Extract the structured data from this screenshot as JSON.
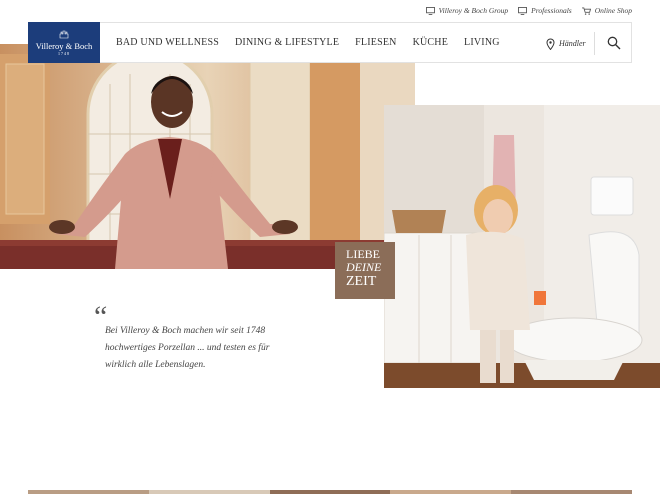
{
  "utility_nav": {
    "group": "Villeroy & Boch Group",
    "professionals": "Professionals",
    "shop": "Online Shop"
  },
  "logo": {
    "brand": "Villeroy & Boch",
    "year": "1748"
  },
  "menu": {
    "items": [
      "BAD UND WELLNESS",
      "DINING & LIFESTYLE",
      "FLIESEN",
      "KÜCHE",
      "LIVING"
    ]
  },
  "header": {
    "dealer_label": "Händler"
  },
  "badge": {
    "line1": "LIEBE",
    "line2": "DEINE",
    "line3": "ZEIT"
  },
  "quote": {
    "mark": "“",
    "text": "Bei Villeroy & Boch machen wir seit 1748 hochwertiges Porzellan ... und testen es für wirklich alle Lebenslagen."
  },
  "colors": {
    "brand_blue": "#1c3d7b",
    "badge_brown": "#8b6d58"
  }
}
